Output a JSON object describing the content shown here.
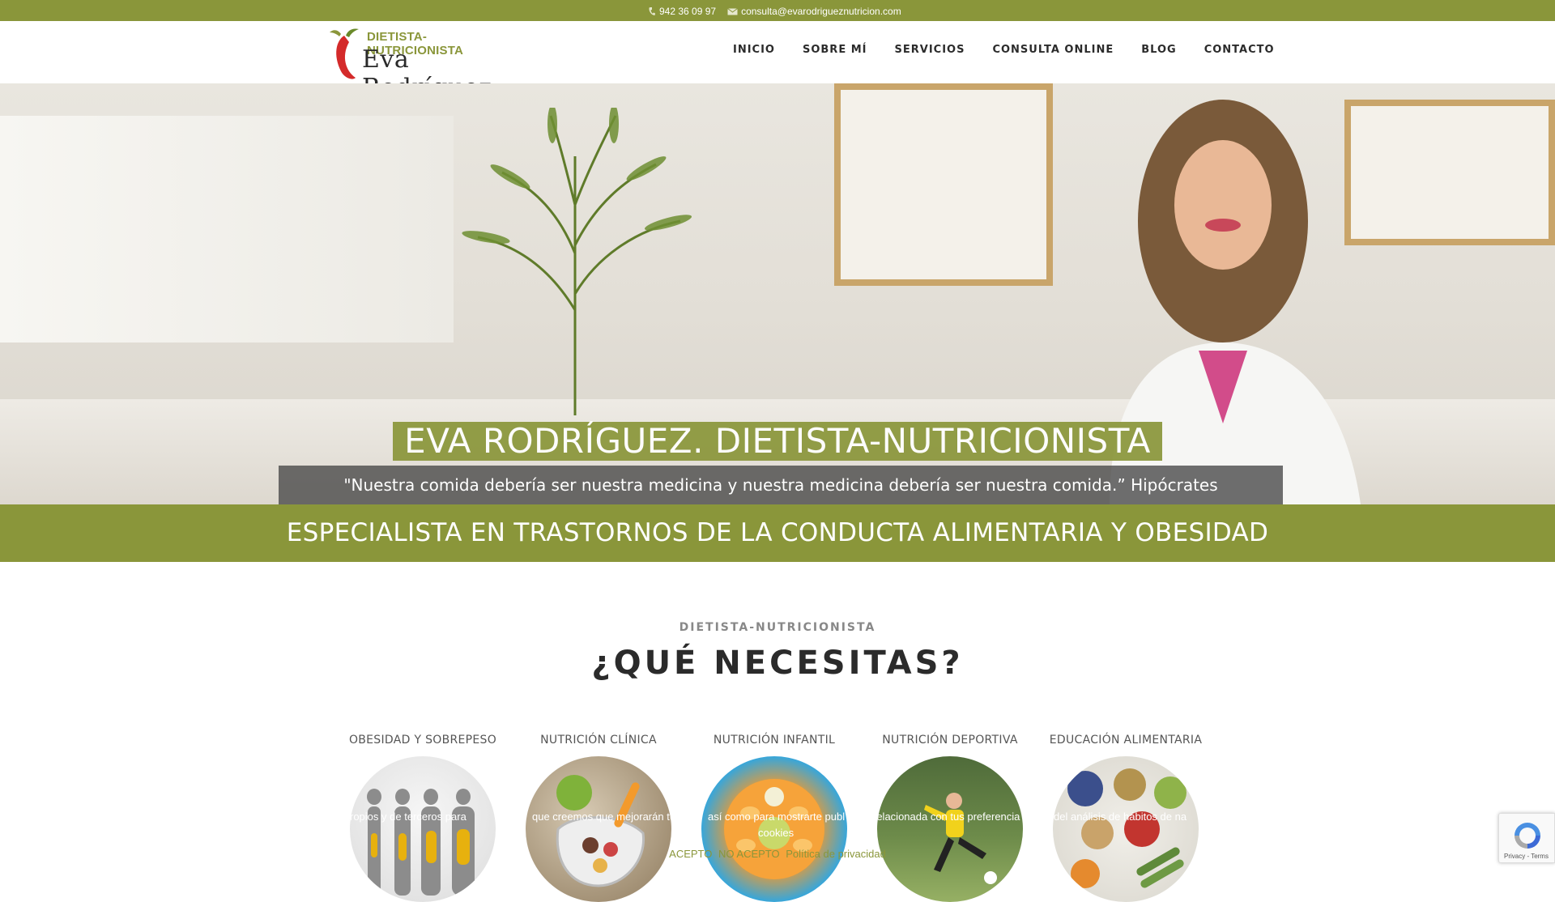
{
  "topbar": {
    "phone": "942 36 09 97",
    "email": "consulta@evarodrigueznutricion.com"
  },
  "logo": {
    "tagline": "DIETISTA-NUTRICIONISTA",
    "name": "Eva Rodríguez"
  },
  "nav": {
    "items": [
      "INICIO",
      "SOBRE MÍ",
      "SERVICIOS",
      "CONSULTA ONLINE",
      "BLOG",
      "CONTACTO"
    ]
  },
  "hero": {
    "title": "EVA RODRÍGUEZ. DIETISTA-NUTRICIONISTA",
    "quote": "\"Nuestra comida debería ser nuestra medicina y nuestra medicina debería ser nuestra comida.” Hipócrates"
  },
  "banner": {
    "text": "ESPECIALISTA EN TRASTORNOS DE LA CONDUCTA ALIMENTARIA Y OBESIDAD"
  },
  "section": {
    "subtitle": "DIETISTA-NUTRICIONISTA",
    "heading": "¿QUÉ NECESITAS?"
  },
  "services": [
    {
      "label": "OBESIDAD Y SOBREPESO"
    },
    {
      "label": "NUTRICIÓN CLÍNICA"
    },
    {
      "label": "NUTRICIÓN INFANTIL"
    },
    {
      "label": "NUTRICIÓN DEPORTIVA"
    },
    {
      "label": "EDUCACIÓN ALIMENTARIA"
    }
  ],
  "cookies": {
    "line1": "ropios y de terceros para",
    "line2": "que creemos que mejorarán tu",
    "line3": "así como para mostrarte publ",
    "line3b": "cookies",
    "line4": "relacionada con tus preferencia",
    "line5": "del análisis de hábitos de na",
    "accept": "ACEPTO",
    "reject": "NO ACEPTO",
    "policy": "Política de privacidad"
  },
  "recaptcha": {
    "links": "Privacy - Terms"
  },
  "colors": {
    "brand_green": "#8a963a",
    "text_dark": "#2b2b2b"
  }
}
